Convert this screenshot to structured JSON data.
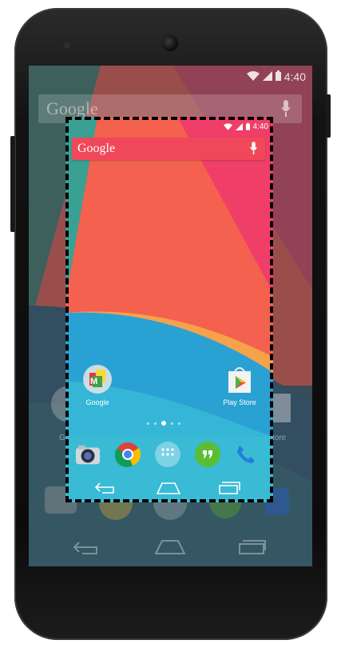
{
  "status_bar": {
    "time": "4:40",
    "icons": [
      "wifi-icon",
      "signal-icon",
      "battery-icon"
    ]
  },
  "search": {
    "logo": "Google",
    "icon": "mic-icon"
  },
  "apps": [
    {
      "label": "Google",
      "icon": "google-folder-icon"
    },
    {
      "label": "Play Store",
      "icon": "play-store-icon"
    }
  ],
  "background_labels": [
    "G",
    "tore"
  ],
  "page_indicator": {
    "pages": 5,
    "current": 2
  },
  "dock": [
    "camera-icon",
    "chrome-icon",
    "app-drawer-icon",
    "hangouts-icon",
    "phone-icon"
  ],
  "nav": [
    "back-icon",
    "home-icon",
    "recents-icon"
  ],
  "colors": {
    "search_bar": "#f0485a",
    "hangouts": "#5bbd34",
    "phone_blue": "#1f7ed8"
  }
}
